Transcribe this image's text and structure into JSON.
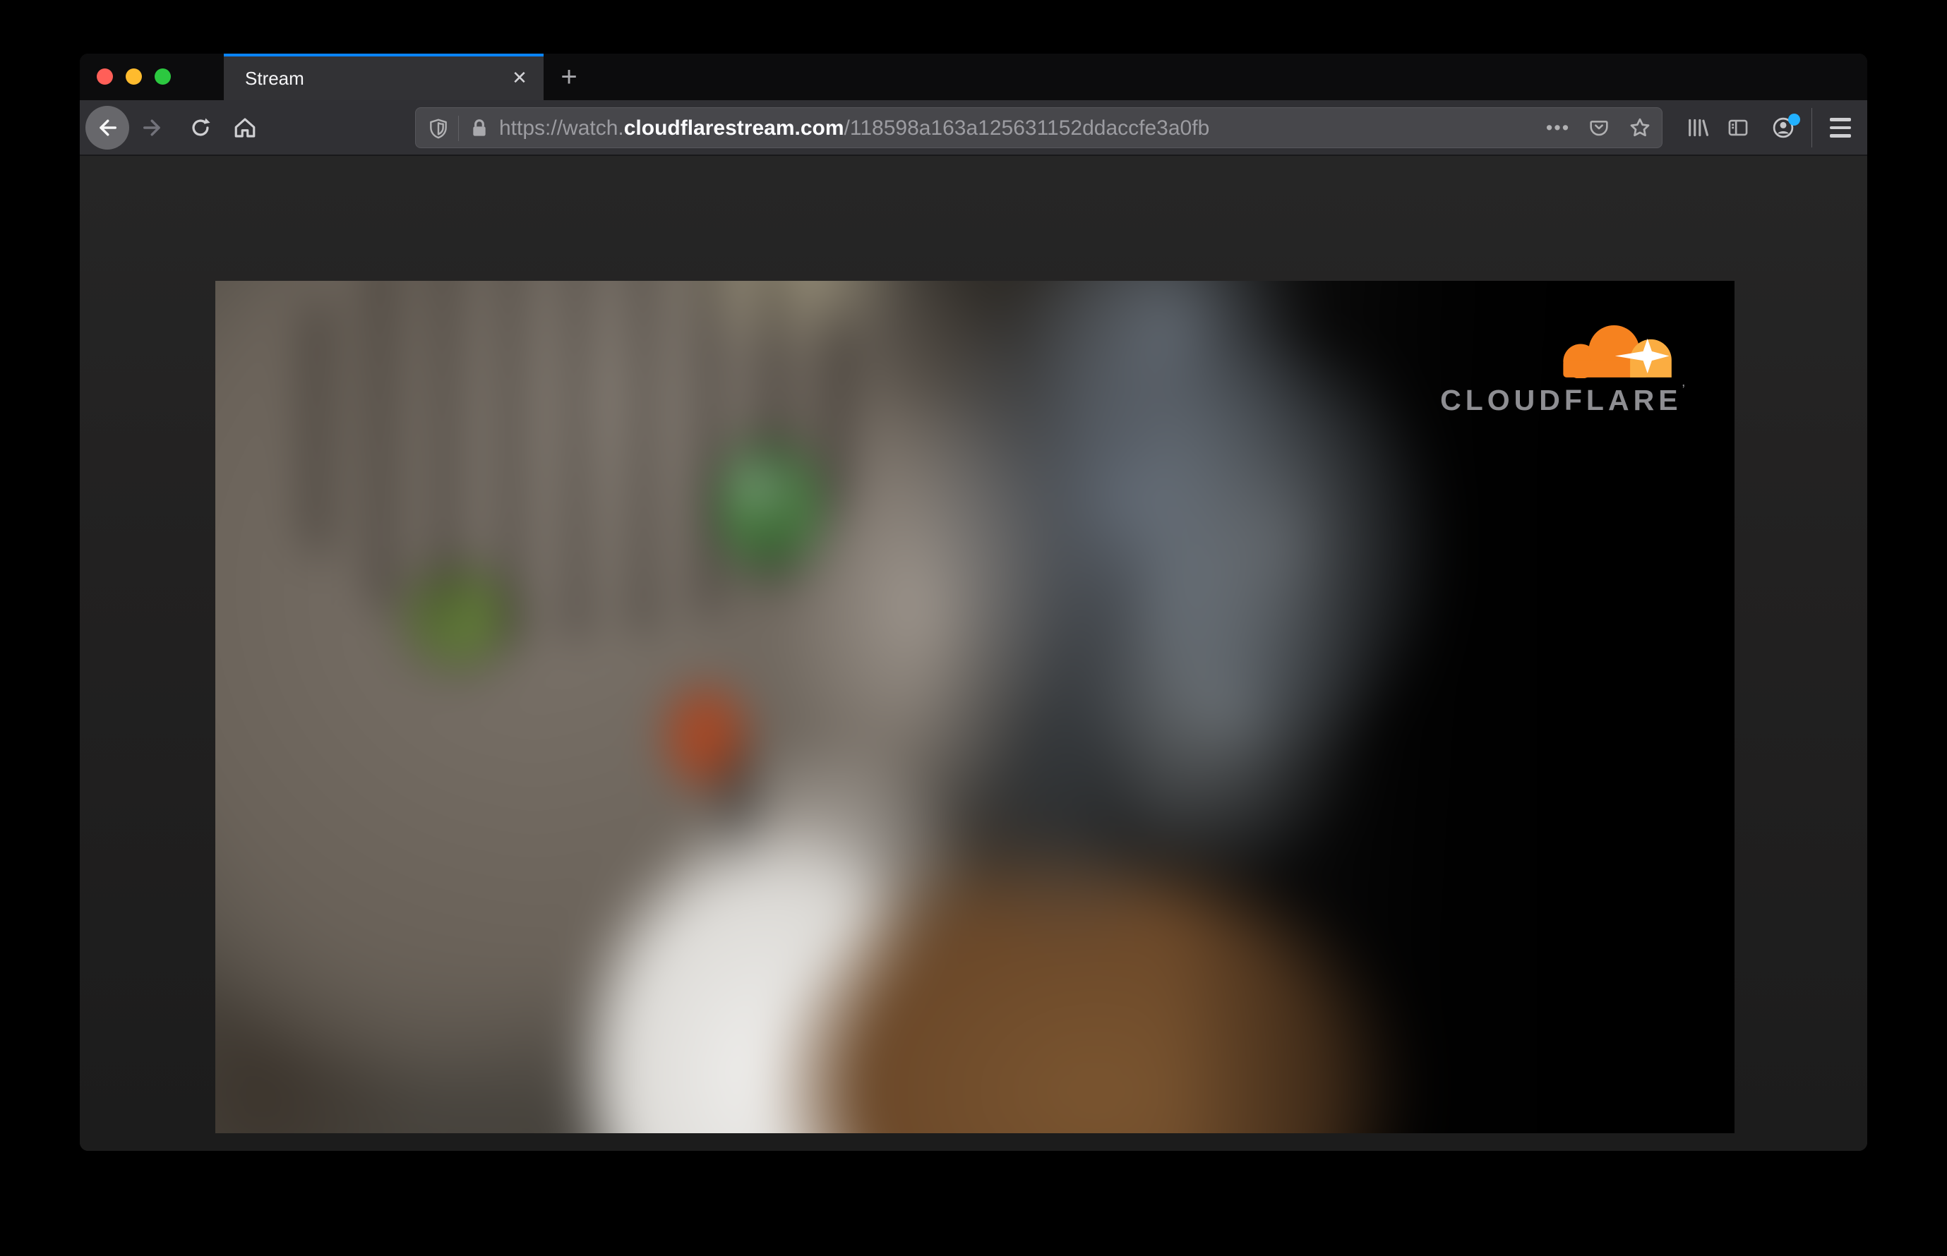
{
  "window": {
    "traffic_lights": [
      {
        "name": "close",
        "color": "#ff5f58"
      },
      {
        "name": "minimize",
        "color": "#febb2e"
      },
      {
        "name": "zoom",
        "color": "#2cc840"
      }
    ]
  },
  "tab_bar": {
    "active_tab": {
      "title": "Stream",
      "close_glyph": "✕",
      "accent_color": "#0a84ff"
    },
    "new_tab_glyph": "+"
  },
  "toolbar": {
    "address_bar": {
      "prefix": "https://watch.",
      "domain": "cloudflarestream.com",
      "path": "/118598a163a125631152ddaccfe3a0fb",
      "page_actions_glyph": "•••"
    },
    "account_badge_color": "#22b1ff",
    "icons": {
      "back": "arrow-left",
      "forward": "arrow-right",
      "refresh": "circular-arrow",
      "home": "house",
      "tracking_protection": "shield",
      "site_security": "padlock",
      "pocket": "pocket-badge",
      "bookmark": "star-outline",
      "library": "books",
      "sidebar": "split-panel",
      "account": "person-circle",
      "menu": "hamburger"
    }
  },
  "page": {
    "video_player": {
      "brand_wordmark": "CLOUDFLARE",
      "brand_trademark_glyph": "’",
      "logo_orange": "#f6821f",
      "logo_orange_light": "#fbad41",
      "wordmark_color": "#8e8e92"
    }
  }
}
